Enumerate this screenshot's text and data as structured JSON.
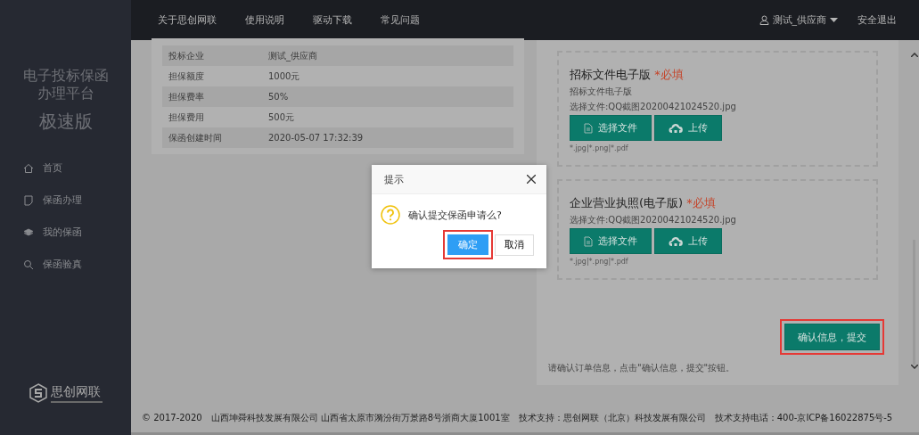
{
  "sidebar": {
    "title_lines": [
      "电子投标保函",
      "办理平台"
    ],
    "edition": "极速版",
    "items": [
      {
        "label": "首页",
        "kind": "home"
      },
      {
        "label": "保函办理",
        "kind": "note"
      },
      {
        "label": "我的保函",
        "kind": "layers"
      },
      {
        "label": "保函验真",
        "kind": "search"
      }
    ],
    "logo": {
      "name": "思创网联"
    }
  },
  "top_nav": {
    "links": [
      "关于思创网联",
      "使用说明",
      "驱动下载",
      "常见问题"
    ],
    "user": "测试_供应商",
    "logout": "安全退出"
  },
  "details": [
    {
      "label": "投标企业",
      "value": "测试_供应商"
    },
    {
      "label": "担保额度",
      "value": "1000元"
    },
    {
      "label": "担保费率",
      "value": "50%"
    },
    {
      "label": "担保费用",
      "value": "500元"
    },
    {
      "label": "保函创建时间",
      "value": "2020-05-07 17:32:39"
    }
  ],
  "uploads": [
    {
      "title": "招标文件电子版",
      "required": "*必填",
      "subtitle": "招标文件电子版",
      "file": "选择文件:QQ截图20200421024520.jpg",
      "choose": "选择文件",
      "upload": "上传",
      "formats": "*.jpg|*.png|*.pdf"
    },
    {
      "title": "企业营业执照(电子版)",
      "required": "*必填",
      "file": "选择文件:QQ截图20200421024520.jpg",
      "choose": "选择文件",
      "upload": "上传",
      "formats": "*.jpg|*.png|*.pdf"
    }
  ],
  "submit": {
    "label": "确认信息，提交",
    "highlighted": true,
    "hint": "请确认订单信息，点击\"确认信息，提交\"按钮。"
  },
  "dialog": {
    "title": "提示",
    "message": "确认提交保函申请么?",
    "ok": "确定",
    "ok_highlighted": true,
    "cancel": "取消"
  },
  "footer": [
    "© 2017-2020",
    "山西坤舜科技发展有限公司 山西省太原市漪汾街万景路8号浙商大厦1001室",
    "技术支持：思创网联（北京）科技发展有限公司",
    "技术支持电话：400-京ICP备16022875号-5"
  ]
}
